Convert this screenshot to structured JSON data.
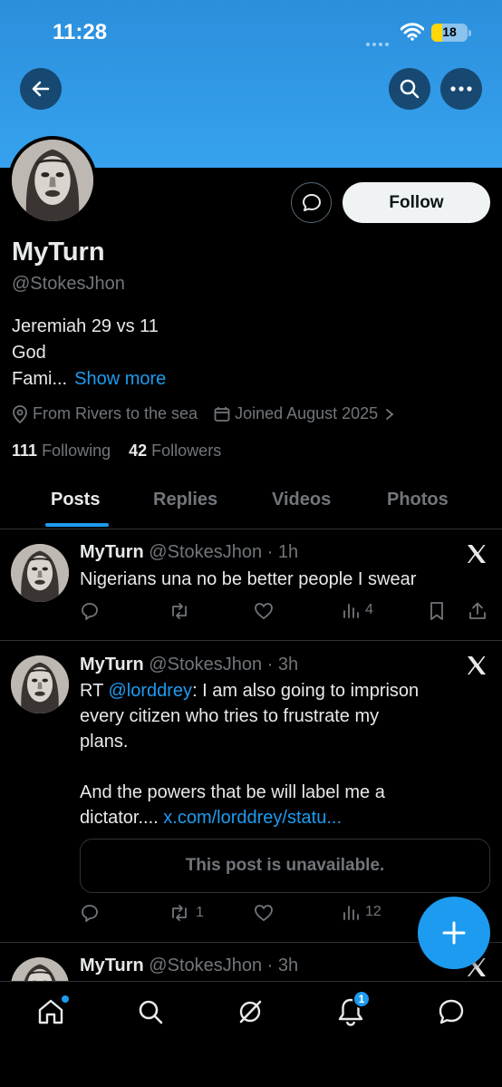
{
  "status_bar": {
    "time": "11:28",
    "battery": "18"
  },
  "profile": {
    "name": "MyTurn",
    "handle": "@StokesJhon",
    "bio_lines": [
      "Jeremiah 29 vs 11",
      "God",
      "Fami..."
    ],
    "show_more": "Show more",
    "location": "From Rivers to the sea",
    "joined": "Joined August 2025",
    "following_count": "111",
    "following_label": "Following",
    "followers_count": "42",
    "followers_label": "Followers",
    "follow_label": "Follow"
  },
  "tabs": [
    "Posts",
    "Replies",
    "Videos",
    "Photos"
  ],
  "posts": [
    {
      "name": "MyTurn",
      "meta": "@StokesJhon · 1h",
      "text": "Nigerians una no be better people I swear",
      "views": "4"
    },
    {
      "name": "MyTurn",
      "meta": "@StokesJhon · 3h",
      "rt_prefix": "RT ",
      "mention": "@lorddrey",
      "line1_rest": ": I am also going to imprison",
      "line2": "every citizen who tries to frustrate my",
      "line3": "plans.",
      "line4": "And the powers that be will label me a",
      "line5_text": "dictator.... ",
      "line5_link": "x.com/lorddrey/statu...",
      "unavailable": "This post is unavailable.",
      "reposts": "1",
      "views": "12"
    },
    {
      "name": "MyTurn",
      "meta": "@StokesJhon · 3h"
    }
  ],
  "nav": {
    "notifications_badge": "1"
  },
  "colors": {
    "accent": "#1d9bf0",
    "banner": "#36a2ee",
    "muted": "#71767b",
    "text": "#e7e9ea",
    "border": "#2f3336"
  }
}
